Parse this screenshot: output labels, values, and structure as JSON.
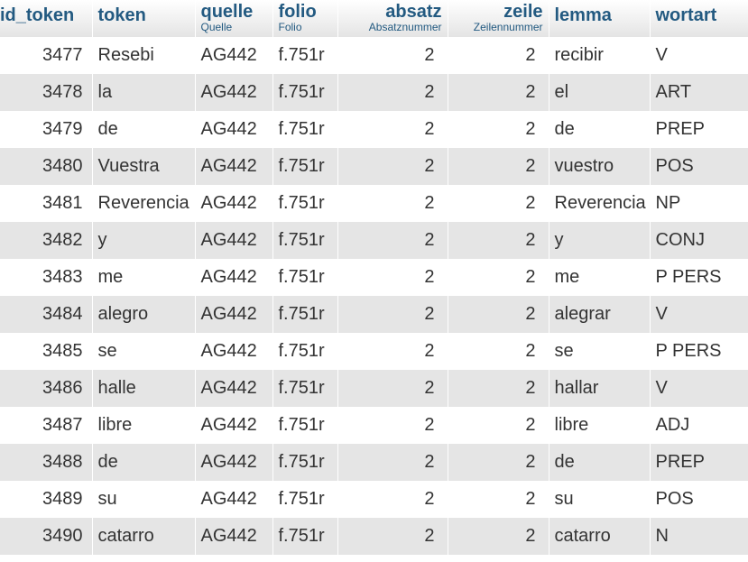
{
  "columns": [
    {
      "key": "id_token",
      "label": "id_token",
      "sub": ""
    },
    {
      "key": "token",
      "label": "token",
      "sub": ""
    },
    {
      "key": "quelle",
      "label": "quelle",
      "sub": "Quelle"
    },
    {
      "key": "folio",
      "label": "folio",
      "sub": "Folio"
    },
    {
      "key": "absatz",
      "label": "absatz",
      "sub": "Absatznummer"
    },
    {
      "key": "zeile",
      "label": "zeile",
      "sub": "Zeilennummer"
    },
    {
      "key": "lemma",
      "label": "lemma",
      "sub": ""
    },
    {
      "key": "wortart",
      "label": "wortart",
      "sub": ""
    }
  ],
  "rows": [
    [
      "3477",
      "Resebi",
      "AG442",
      "f.751r",
      "2",
      "2",
      "recibir",
      "V"
    ],
    [
      "3478",
      "la",
      "AG442",
      "f.751r",
      "2",
      "2",
      "el",
      "ART"
    ],
    [
      "3479",
      "de",
      "AG442",
      "f.751r",
      "2",
      "2",
      "de",
      "PREP"
    ],
    [
      "3480",
      "Vuestra",
      "AG442",
      "f.751r",
      "2",
      "2",
      "vuestro",
      "POS"
    ],
    [
      "3481",
      "Reverencia",
      "AG442",
      "f.751r",
      "2",
      "2",
      "Reverencia",
      "NP"
    ],
    [
      "3482",
      "y",
      "AG442",
      "f.751r",
      "2",
      "2",
      "y",
      "CONJ"
    ],
    [
      "3483",
      "me",
      "AG442",
      "f.751r",
      "2",
      "2",
      "me",
      "P PERS"
    ],
    [
      "3484",
      "alegro",
      "AG442",
      "f.751r",
      "2",
      "2",
      "alegrar",
      "V"
    ],
    [
      "3485",
      "se",
      "AG442",
      "f.751r",
      "2",
      "2",
      "se",
      "P PERS"
    ],
    [
      "3486",
      "halle",
      "AG442",
      "f.751r",
      "2",
      "2",
      "hallar",
      "V"
    ],
    [
      "3487",
      "libre",
      "AG442",
      "f.751r",
      "2",
      "2",
      "libre",
      "ADJ"
    ],
    [
      "3488",
      "de",
      "AG442",
      "f.751r",
      "2",
      "2",
      "de",
      "PREP"
    ],
    [
      "3489",
      "su",
      "AG442",
      "f.751r",
      "2",
      "2",
      "su",
      "POS"
    ],
    [
      "3490",
      "catarro",
      "AG442",
      "f.751r",
      "2",
      "2",
      "catarro",
      "N"
    ]
  ],
  "colors": {
    "header_text": "#235a81",
    "row_alt": "#e5e5e5",
    "cell_text": "#333333"
  }
}
